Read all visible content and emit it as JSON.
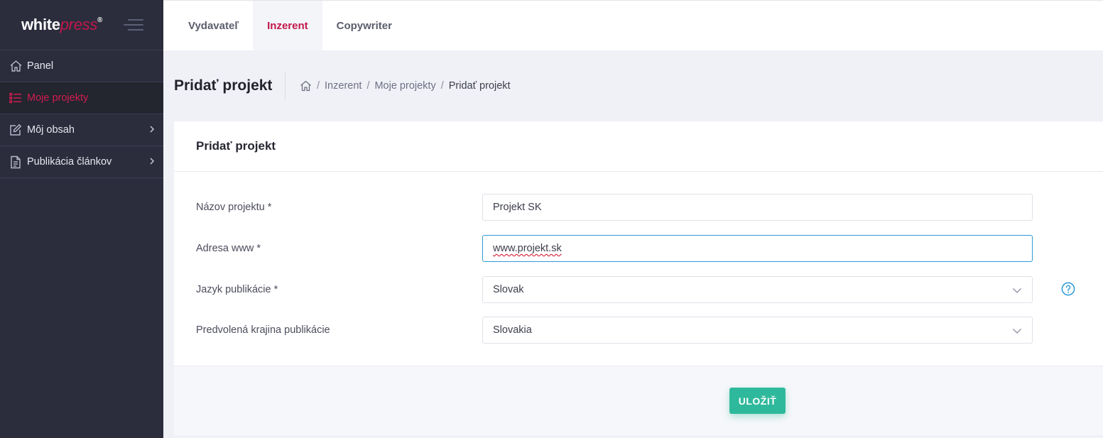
{
  "brand": {
    "logo_part1": "white",
    "logo_part2": "press",
    "logo_mark": "®"
  },
  "sidebar": {
    "items": [
      {
        "label": "Panel",
        "icon": "home-icon"
      },
      {
        "label": "Moje projekty",
        "icon": "list-icon",
        "active": true
      },
      {
        "label": "Môj obsah",
        "icon": "edit-icon",
        "has_submenu": true
      },
      {
        "label": "Publikácia článkov",
        "icon": "document-icon",
        "has_submenu": true
      }
    ]
  },
  "topbar": {
    "tabs": [
      {
        "label": "Vydavateľ"
      },
      {
        "label": "Inzerent",
        "active": true
      },
      {
        "label": "Copywriter"
      }
    ]
  },
  "subheader": {
    "title": "Pridať projekt",
    "breadcrumb": [
      "Inzerent",
      "Moje projekty",
      "Pridať projekt"
    ],
    "separator": "/"
  },
  "form": {
    "title": "Pridať projekt",
    "fields": [
      {
        "label": "Názov projektu *",
        "value": "Projekt SK"
      },
      {
        "label": "Adresa www *",
        "value": "www.projekt.sk"
      },
      {
        "label": "Jazyk publikácie *",
        "value": "Slovak"
      },
      {
        "label": "Predvolená krajina publikácie",
        "value": "Slovakia"
      }
    ],
    "save_label": "ULOŽIŤ"
  },
  "colors": {
    "sidebar_bg": "#2b2d3d",
    "accent": "#c2174b",
    "save_button": "#2fb99c",
    "help_icon": "#2d9ad6"
  }
}
